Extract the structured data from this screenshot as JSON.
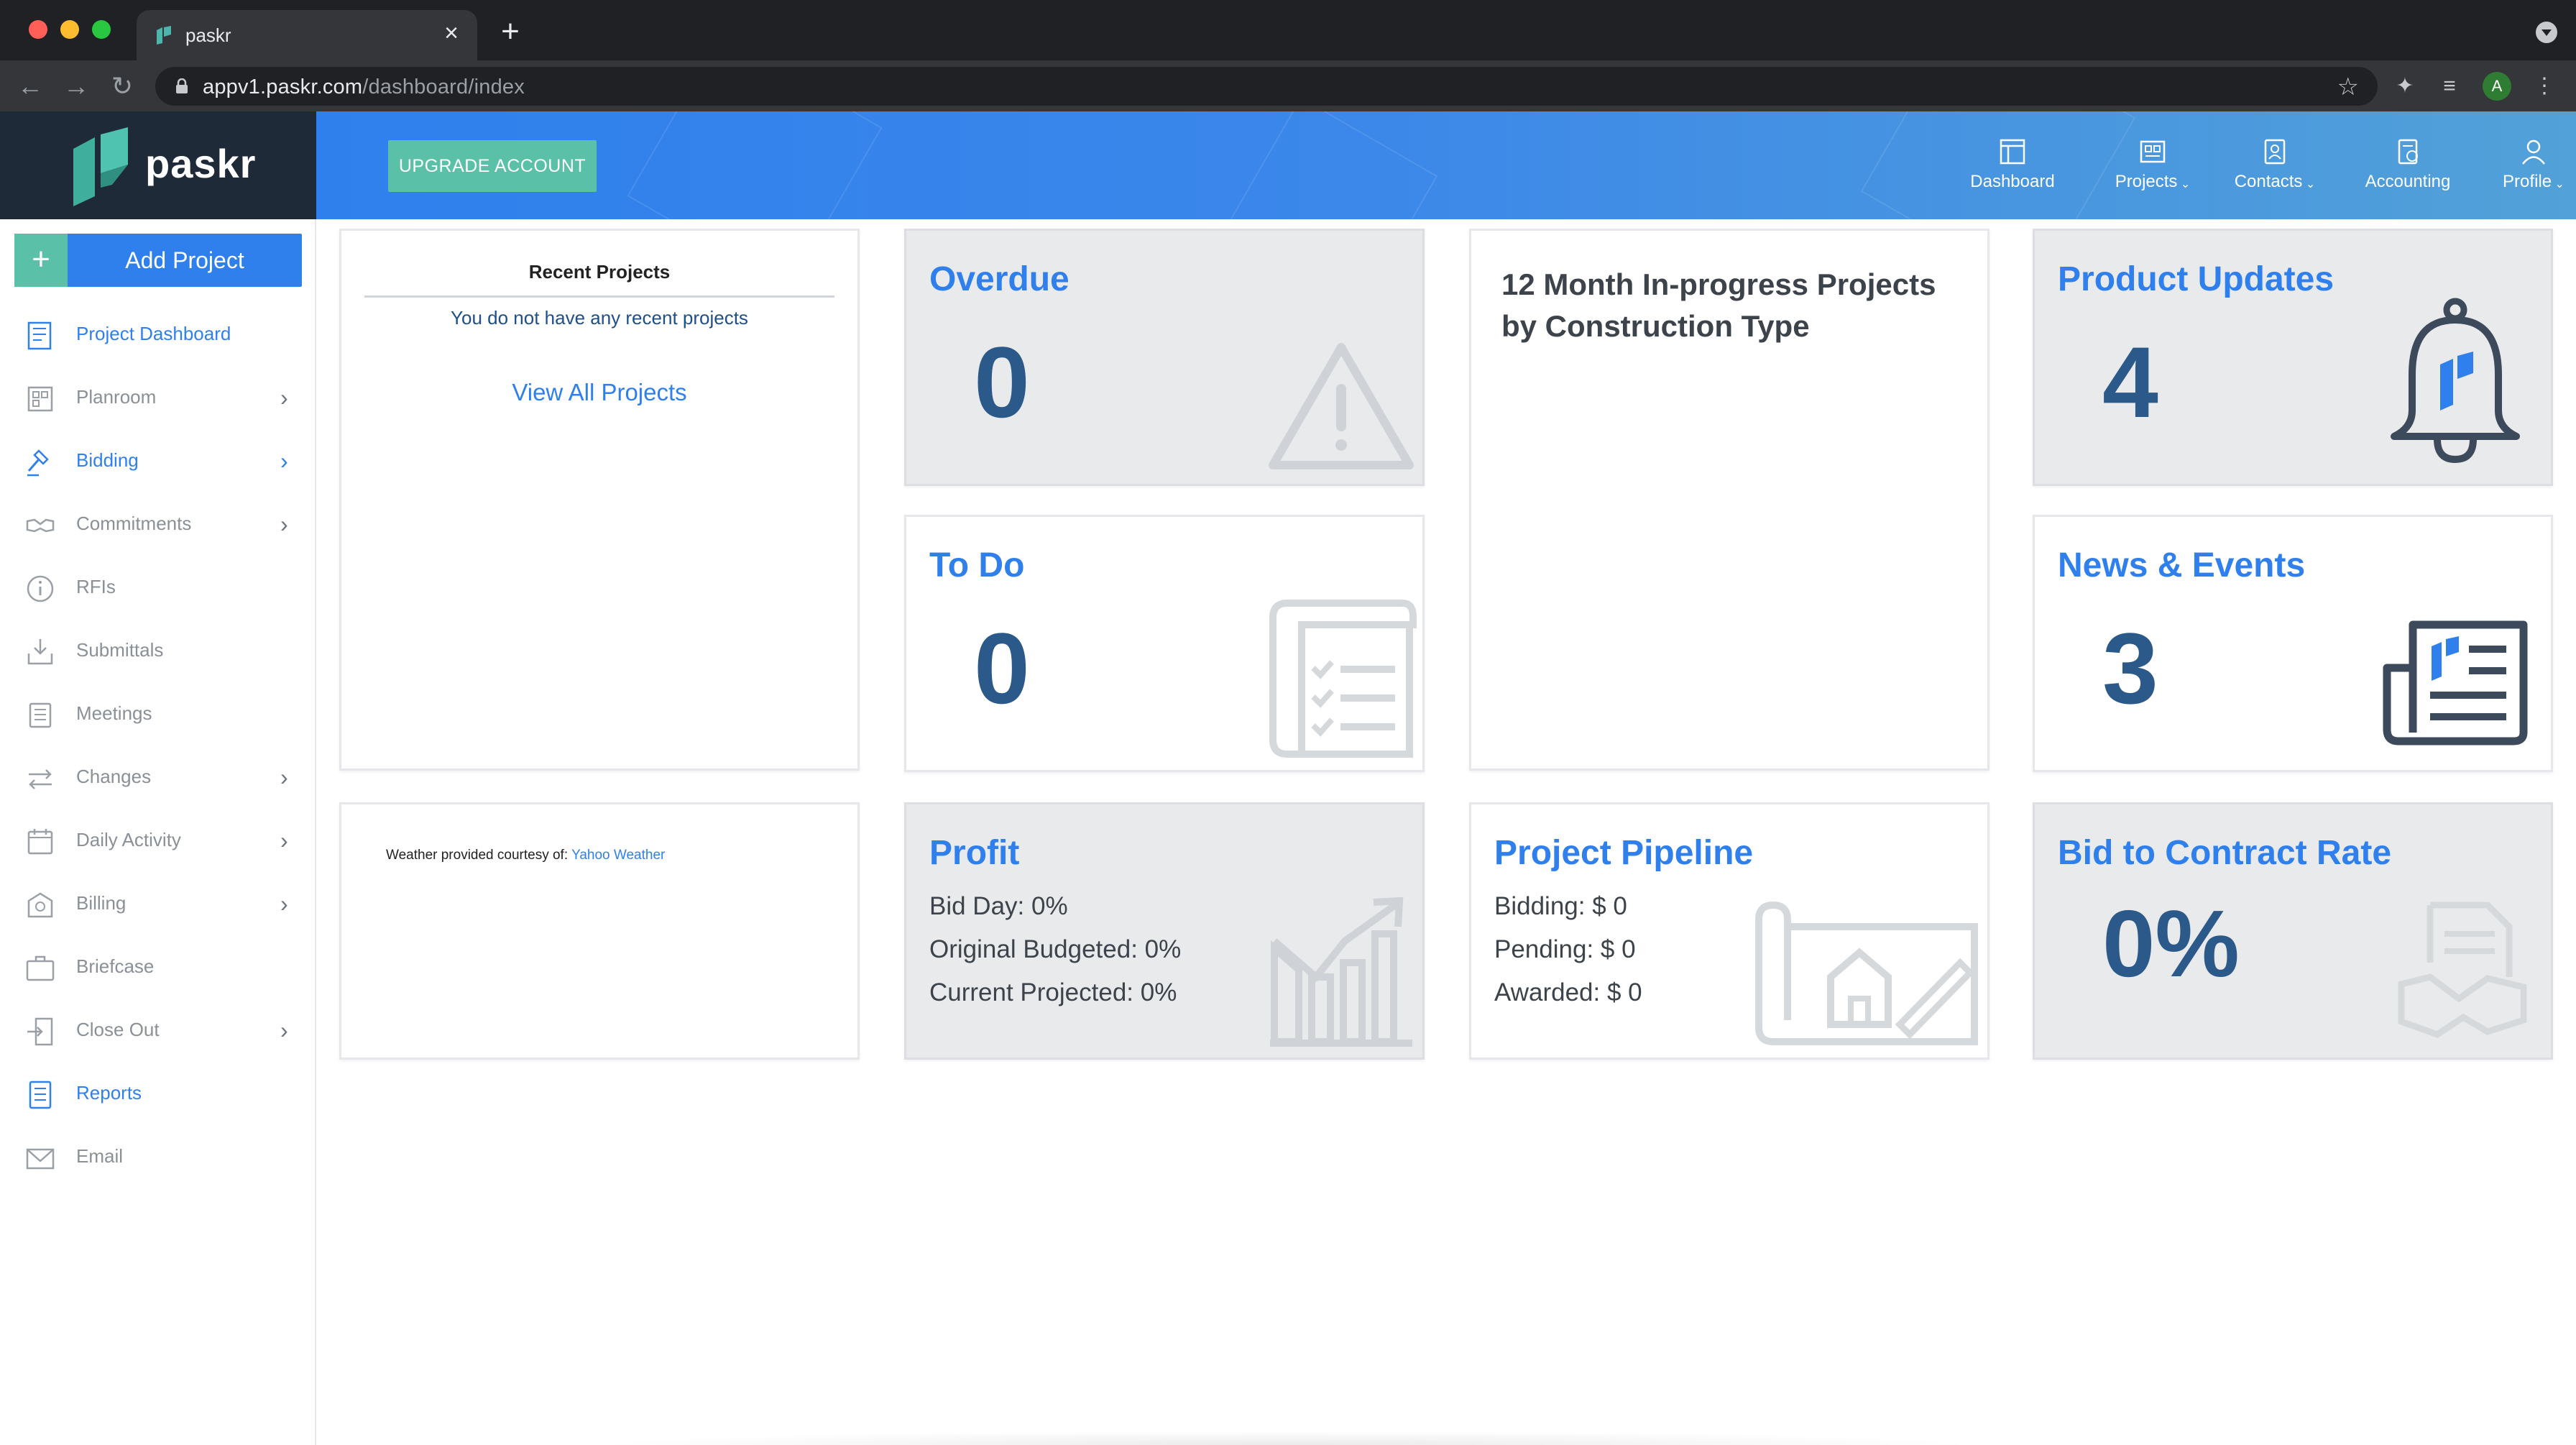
{
  "browser": {
    "tab_title": "paskr",
    "url_host": "appv1.paskr.com",
    "url_path": "/dashboard/index",
    "avatar_letter": "A",
    "icons": [
      "back-icon",
      "forward-icon",
      "reload-icon",
      "lock-icon",
      "star-icon",
      "extensions-icon",
      "reading-list-icon",
      "menu-icon"
    ]
  },
  "header": {
    "logo_text": "paskr",
    "upgrade_label": "UPGRADE ACCOUNT",
    "nav": [
      {
        "label": "Dashboard",
        "icon": "dashboard-icon",
        "caret": ""
      },
      {
        "label": "Projects",
        "icon": "projects-icon",
        "caret": "⌄"
      },
      {
        "label": "Contacts",
        "icon": "contacts-icon",
        "caret": "⌄"
      },
      {
        "label": "Accounting",
        "icon": "accounting-icon",
        "caret": ""
      },
      {
        "label": "Profile",
        "icon": "profile-icon",
        "caret": "⌄"
      }
    ]
  },
  "sidebar": {
    "add_plus": "+",
    "add_label": "Add Project",
    "items": [
      {
        "label": "Project Dashboard",
        "icon": "dashboard-icon",
        "active": true,
        "chevron": ""
      },
      {
        "label": "Planroom",
        "icon": "planroom-icon",
        "active": false,
        "chevron": "›"
      },
      {
        "label": "Bidding",
        "icon": "gavel-icon",
        "active": true,
        "chevron": "›"
      },
      {
        "label": "Commitments",
        "icon": "handshake-icon",
        "active": false,
        "chevron": "›"
      },
      {
        "label": "RFIs",
        "icon": "info-icon",
        "active": false,
        "chevron": ""
      },
      {
        "label": "Submittals",
        "icon": "submittal-icon",
        "active": false,
        "chevron": ""
      },
      {
        "label": "Meetings",
        "icon": "meetings-icon",
        "active": false,
        "chevron": ""
      },
      {
        "label": "Changes",
        "icon": "arrows-icon",
        "active": false,
        "chevron": "›"
      },
      {
        "label": "Daily Activity",
        "icon": "calendar-icon",
        "active": false,
        "chevron": "›"
      },
      {
        "label": "Billing",
        "icon": "billing-icon",
        "active": false,
        "chevron": "›"
      },
      {
        "label": "Briefcase",
        "icon": "briefcase-icon",
        "active": false,
        "chevron": ""
      },
      {
        "label": "Close Out",
        "icon": "door-icon",
        "active": false,
        "chevron": "›"
      },
      {
        "label": "Reports",
        "icon": "reports-icon",
        "active": true,
        "chevron": ""
      },
      {
        "label": "Email",
        "icon": "mail-icon",
        "active": false,
        "chevron": ""
      }
    ]
  },
  "recent": {
    "title": "Recent Projects",
    "empty": "You do not have any recent projects",
    "view_all": "View All Projects"
  },
  "weather": {
    "prefix": "Weather provided courtesy of:",
    "link": "Yahoo Weather"
  },
  "overdue": {
    "title": "Overdue",
    "value": "0"
  },
  "todo": {
    "title": "To Do",
    "value": "0"
  },
  "month_chart": {
    "title_line1": "12 Month In-progress Projects",
    "title_line2": "by Construction Type"
  },
  "updates": {
    "title": "Product Updates",
    "value": "4"
  },
  "news": {
    "title": "News & Events",
    "value": "3"
  },
  "profit": {
    "title": "Profit",
    "lines": [
      "Bid Day: 0%",
      "Original Budgeted: 0%",
      "Current Projected: 0%"
    ]
  },
  "pipeline": {
    "title": "Project Pipeline",
    "lines": [
      "Bidding: $ 0",
      "Pending: $ 0",
      "Awarded: $ 0"
    ]
  },
  "bid_rate": {
    "title": "Bid to Contract Rate",
    "value": "0%"
  },
  "colors": {
    "accent": "#2f80ed",
    "teal": "#5bc0a8",
    "dark": "#1f2a38",
    "number": "#2b5a8a"
  }
}
